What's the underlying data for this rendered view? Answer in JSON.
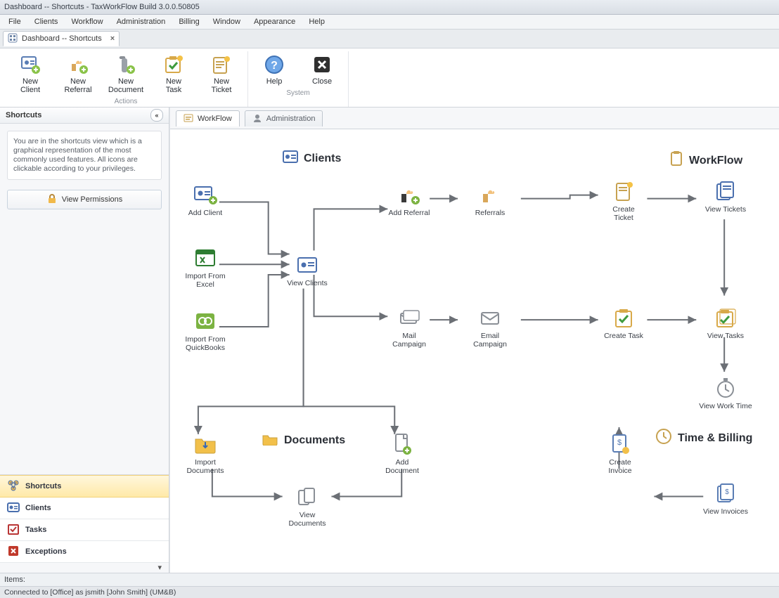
{
  "window": {
    "title": "Dashboard -- Shortcuts - TaxWorkFlow Build 3.0.0.50805"
  },
  "menu": {
    "file": "File",
    "clients": "Clients",
    "workflow": "Workflow",
    "administration": "Administration",
    "billing": "Billing",
    "window": "Window",
    "appearance": "Appearance",
    "help": "Help"
  },
  "doctab": {
    "label": "Dashboard -- Shortcuts"
  },
  "ribbon": {
    "actions_title": "Actions",
    "system_title": "System",
    "new_client": "New\nClient",
    "new_referral": "New\nReferral",
    "new_document": "New\nDocument",
    "new_task": "New\nTask",
    "new_ticket": "New\nTicket",
    "help": "Help",
    "close": "Close"
  },
  "sidebar": {
    "title": "Shortcuts",
    "description": "You are in the shortcuts view which is a graphical representation of the most commonly used features. All icons are clickable according to your privileges.",
    "view_permissions": "View Permissions",
    "nav": {
      "shortcuts": "Shortcuts",
      "clients": "Clients",
      "tasks": "Tasks",
      "exceptions": "Exceptions"
    }
  },
  "maintabs": {
    "workflow": "WorkFlow",
    "administration": "Administration"
  },
  "sections": {
    "clients": "Clients",
    "workflow": "WorkFlow",
    "documents": "Documents",
    "time_billing": "Time & Billing"
  },
  "nodes": {
    "add_client": "Add Client",
    "import_excel": "Import From\nExcel",
    "import_qb": "Import From\nQuickBooks",
    "view_clients": "View Clients",
    "add_referral": "Add Referral",
    "referrals": "Referrals",
    "mail_campaign": "Mail\nCampaign",
    "email_campaign": "Email\nCampaign",
    "create_ticket": "Create\nTicket",
    "view_tickets": "View Tickets",
    "create_task": "Create Task",
    "view_tasks": "View Tasks",
    "view_work_time": "View Work Time",
    "create_invoice": "Create\nInvoice",
    "view_invoices": "View Invoices",
    "import_documents": "Import\nDocuments",
    "add_document": "Add\nDocument",
    "view_documents": "View\nDocuments"
  },
  "statusbar": {
    "items": "Items:"
  },
  "footer": {
    "text": "Connected to [Office] as jsmith [John Smith]  (UM&B)"
  }
}
